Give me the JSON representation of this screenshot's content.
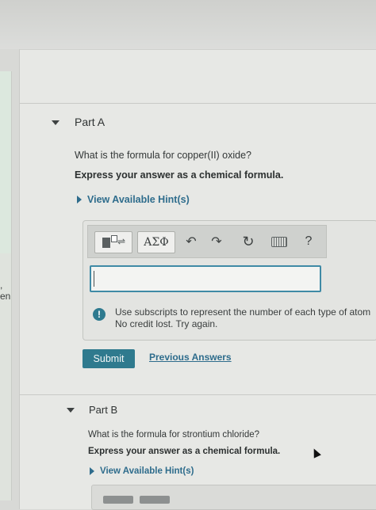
{
  "left_fragments": [
    ",",
    "en"
  ],
  "part_a": {
    "title": "Part A",
    "question": "What is the formula for copper(II) oxide?",
    "instruction": "Express your answer as a chemical formula.",
    "hint": "View Available Hint(s)",
    "toolbar": {
      "greek": "ΑΣΦ",
      "undo": "↶",
      "redo": "↷",
      "reset": "↻",
      "help": "?"
    },
    "answer": {
      "value": "",
      "placeholder": ""
    },
    "feedback": {
      "icon": "!",
      "line1": "Use subscripts to represent the number of each type of atom",
      "line2": "No credit lost. Try again."
    },
    "submit": "Submit",
    "previous": "Previous Answers"
  },
  "part_b": {
    "title": "Part B",
    "question": "What is the formula for strontium chloride?",
    "instruction": "Express your answer as a chemical formula.",
    "hint": "View Available Hint(s)"
  },
  "colors": {
    "accent": "#2f7a8e",
    "link": "#2e6c8c",
    "input_border": "#3f8aa6"
  }
}
